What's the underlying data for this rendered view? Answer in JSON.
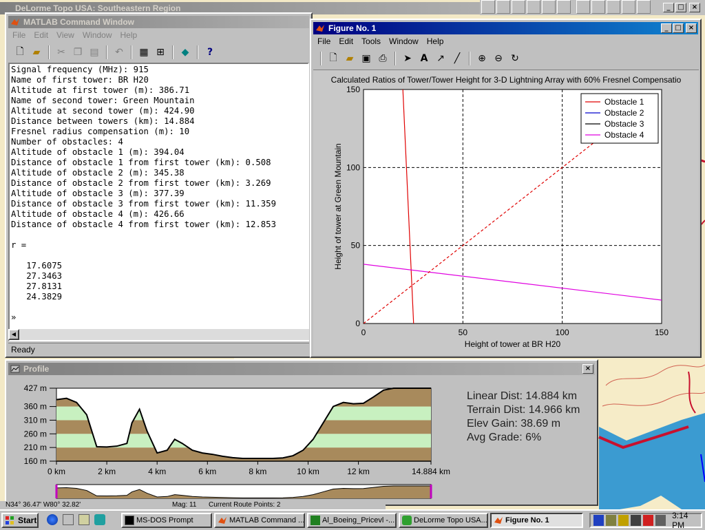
{
  "desktop": {
    "background_window_title": "DeLorme Topo USA: Southeastern Region",
    "status_strip": [
      "N34° 36.47'  W80° 32.82'",
      "Mag: 11",
      "Current Route Points: 2"
    ]
  },
  "matlab": {
    "title": "MATLAB Command Window",
    "menu": [
      "File",
      "Edit",
      "View",
      "Window",
      "Help"
    ],
    "toolbar_icons": [
      "new-file-icon",
      "open-folder-icon",
      "cut-icon",
      "copy-icon",
      "paste-icon",
      "undo-icon",
      "workspace-icon",
      "path-icon",
      "simulink-icon",
      "help-icon"
    ],
    "lines": [
      "Signal frequency (MHz): 915",
      "Name of first tower: BR H20",
      "Altitude at first tower (m): 386.71",
      "Name of second tower: Green Mountain",
      "Altitude at second tower (m): 424.90",
      "Distance between towers (km): 14.884",
      "Fresnel radius compensation (m): 10",
      "Number of obstacles: 4",
      "Altitude of obstacle 1 (m): 394.04",
      "Distance of obstacle 1 from first tower (km): 0.508",
      "Altitude of obstacle 2 (m): 345.38",
      "Distance of obstacle 2 from first tower (km): 3.269",
      "Altitude of obstacle 3 (m): 377.39",
      "Distance of obstacle 3 from first tower (km): 11.359",
      "Altitude of obstacle 4 (m): 426.66",
      "Distance of obstacle 4 from first tower (km): 12.853",
      "",
      "r =",
      "",
      "   17.6075",
      "   27.3463",
      "   27.8131",
      "   24.3829",
      "",
      "»"
    ],
    "status": "Ready"
  },
  "figure": {
    "title": "Figure No. 1",
    "menu": [
      "File",
      "Edit",
      "Tools",
      "Window",
      "Help"
    ],
    "toolbar_icons": [
      "new-figure-icon",
      "open-icon",
      "save-icon",
      "print-icon",
      "select-arrow-icon",
      "text-tool-icon",
      "arrow-tool-icon",
      "line-tool-icon",
      "zoom-in-icon",
      "zoom-out-icon",
      "rotate-icon"
    ],
    "chart_data": {
      "type": "line",
      "title": "Calculated Ratios of Tower/Tower Height for 3-D Lightning Array with 60% Fresnel Compensatio",
      "xlabel": "Height of tower at BR H20",
      "ylabel": "Height of tower at Green Mountain",
      "xlim": [
        0,
        150
      ],
      "ylim": [
        0,
        150
      ],
      "xticks": [
        "0",
        "50",
        "100",
        "150"
      ],
      "yticks": [
        "0",
        "50",
        "100",
        "150"
      ],
      "grid": true,
      "legend_position": "top-right",
      "series": [
        {
          "name": "Obstacle 1",
          "color": "#e00000",
          "x": [
            19.8,
            25.2
          ],
          "y": [
            150,
            0
          ]
        },
        {
          "name": "Obstacle 2",
          "color": "#0000cc",
          "x": [],
          "y": []
        },
        {
          "name": "Obstacle 3",
          "color": "#000000",
          "x": [],
          "y": []
        },
        {
          "name": "Obstacle 4",
          "color": "#e000e0",
          "x": [
            0,
            150
          ],
          "y": [
            38,
            15
          ]
        },
        {
          "name": "",
          "color": "#e00000",
          "dashed": true,
          "x": [
            0,
            120
          ],
          "y": [
            0,
            120
          ]
        }
      ]
    }
  },
  "profile": {
    "title": "Profile",
    "y_labels": [
      "427 m",
      "360 m",
      "310 m",
      "260 m",
      "210 m",
      "160 m"
    ],
    "x_labels": [
      "0 km",
      "2 km",
      "4 km",
      "6 km",
      "8 km",
      "10 km",
      "12 km",
      "14.884 km"
    ],
    "stats": {
      "linear": "Linear Dist: 14.884 km",
      "terrain": "Terrain Dist: 14.966 km",
      "gain": "Elev Gain: 38.69 m",
      "grade": "Avg Grade: 6%"
    },
    "profile_data": {
      "x_km": [
        0,
        0.4,
        0.8,
        1.2,
        1.6,
        2.0,
        2.4,
        2.8,
        3.0,
        3.3,
        3.6,
        4.0,
        4.4,
        4.7,
        5.0,
        5.4,
        5.8,
        6.2,
        6.6,
        7.0,
        7.4,
        7.8,
        8.2,
        8.6,
        9.0,
        9.4,
        9.8,
        10.2,
        10.6,
        11.0,
        11.4,
        11.8,
        12.2,
        12.6,
        13.0,
        13.4,
        13.8,
        14.2,
        14.884
      ],
      "elev_m": [
        385,
        390,
        375,
        330,
        213,
        212,
        215,
        225,
        300,
        350,
        270,
        190,
        200,
        240,
        225,
        200,
        190,
        185,
        178,
        173,
        170,
        170,
        170,
        170,
        172,
        180,
        200,
        240,
        300,
        360,
        375,
        370,
        372,
        395,
        420,
        427,
        427,
        427,
        427
      ]
    }
  },
  "taskbar": {
    "start": "Start",
    "tasks": [
      "MS-DOS Prompt",
      "MATLAB Command ...",
      "Al_Boeing_Pricevl -...",
      "DeLorme Topo USA...",
      "Figure No. 1"
    ],
    "clock": "3:14 PM"
  }
}
